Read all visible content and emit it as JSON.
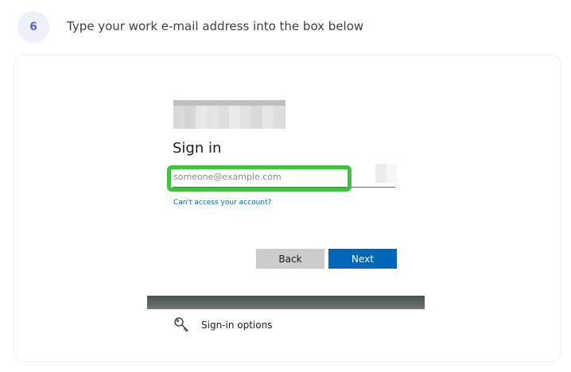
{
  "step": {
    "number": "6",
    "instruction": "Type your work e-mail address into the box below"
  },
  "signin": {
    "title": "Sign in",
    "email_placeholder": "someone@example.com",
    "email_value": "",
    "cant_access": "Can't access your account?",
    "back_label": "Back",
    "next_label": "Next",
    "options_label": "Sign-in options",
    "options_icon": "key-icon"
  },
  "colors": {
    "highlight": "#3cc43c",
    "primary": "#0067b8",
    "badge_bg": "#eef0fb",
    "badge_text": "#5b67d8"
  }
}
